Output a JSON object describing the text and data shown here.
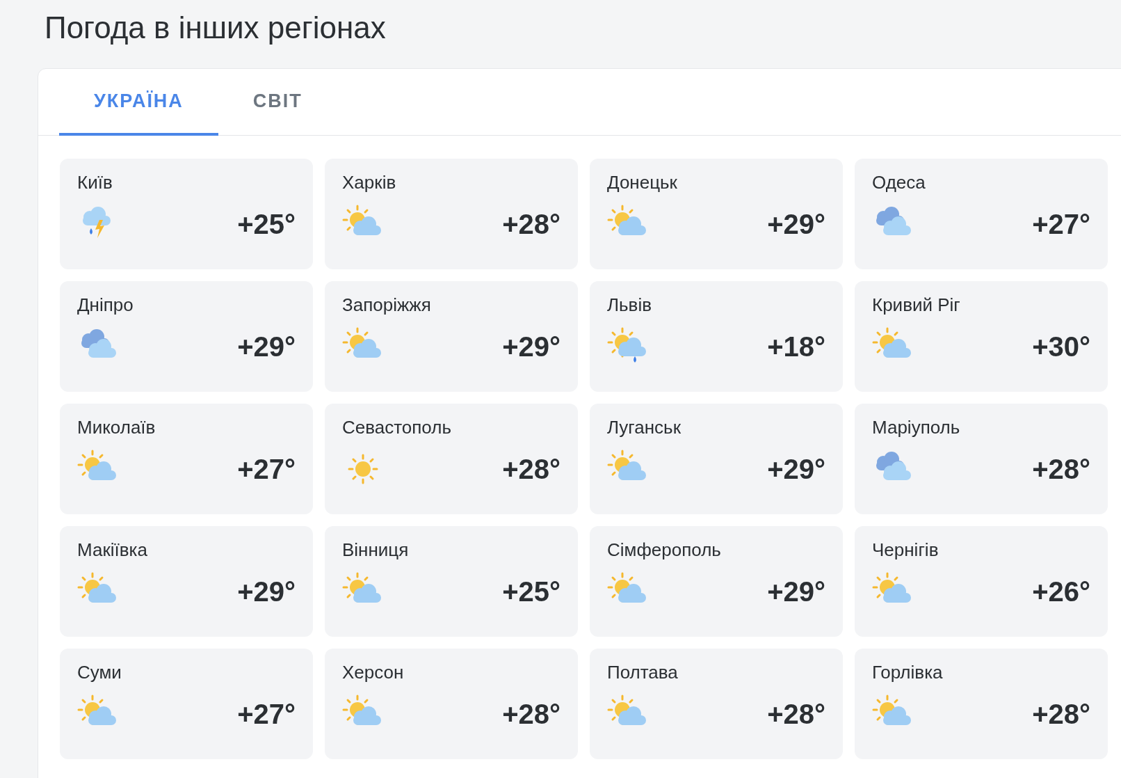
{
  "title": "Погода в інших регіонах",
  "tabs": [
    {
      "label": "УКРАЇНА",
      "selected": true
    },
    {
      "label": "СВІТ",
      "selected": false
    }
  ],
  "cities": [
    {
      "name": "Київ",
      "temp": "+25°",
      "kind": "storm"
    },
    {
      "name": "Харків",
      "temp": "+28°",
      "kind": "partly"
    },
    {
      "name": "Донецьк",
      "temp": "+29°",
      "kind": "partly"
    },
    {
      "name": "Одеса",
      "temp": "+27°",
      "kind": "cloudy"
    },
    {
      "name": "Дніпро",
      "temp": "+29°",
      "kind": "cloudy"
    },
    {
      "name": "Запоріжжя",
      "temp": "+29°",
      "kind": "partly"
    },
    {
      "name": "Львів",
      "temp": "+18°",
      "kind": "shower"
    },
    {
      "name": "Кривий Ріг",
      "temp": "+30°",
      "kind": "partly"
    },
    {
      "name": "Миколаїв",
      "temp": "+27°",
      "kind": "partly"
    },
    {
      "name": "Севастополь",
      "temp": "+28°",
      "kind": "sunny"
    },
    {
      "name": "Луганськ",
      "temp": "+29°",
      "kind": "partly"
    },
    {
      "name": "Маріуполь",
      "temp": "+28°",
      "kind": "cloudy"
    },
    {
      "name": "Макіївка",
      "temp": "+29°",
      "kind": "partly"
    },
    {
      "name": "Вінниця",
      "temp": "+25°",
      "kind": "partly"
    },
    {
      "name": "Сімферополь",
      "temp": "+29°",
      "kind": "partly"
    },
    {
      "name": "Чернігів",
      "temp": "+26°",
      "kind": "partly"
    },
    {
      "name": "Суми",
      "temp": "+27°",
      "kind": "partly"
    },
    {
      "name": "Херсон",
      "temp": "+28°",
      "kind": "partly"
    },
    {
      "name": "Полтава",
      "temp": "+28°",
      "kind": "partly"
    },
    {
      "name": "Горлівка",
      "temp": "+28°",
      "kind": "partly"
    }
  ]
}
